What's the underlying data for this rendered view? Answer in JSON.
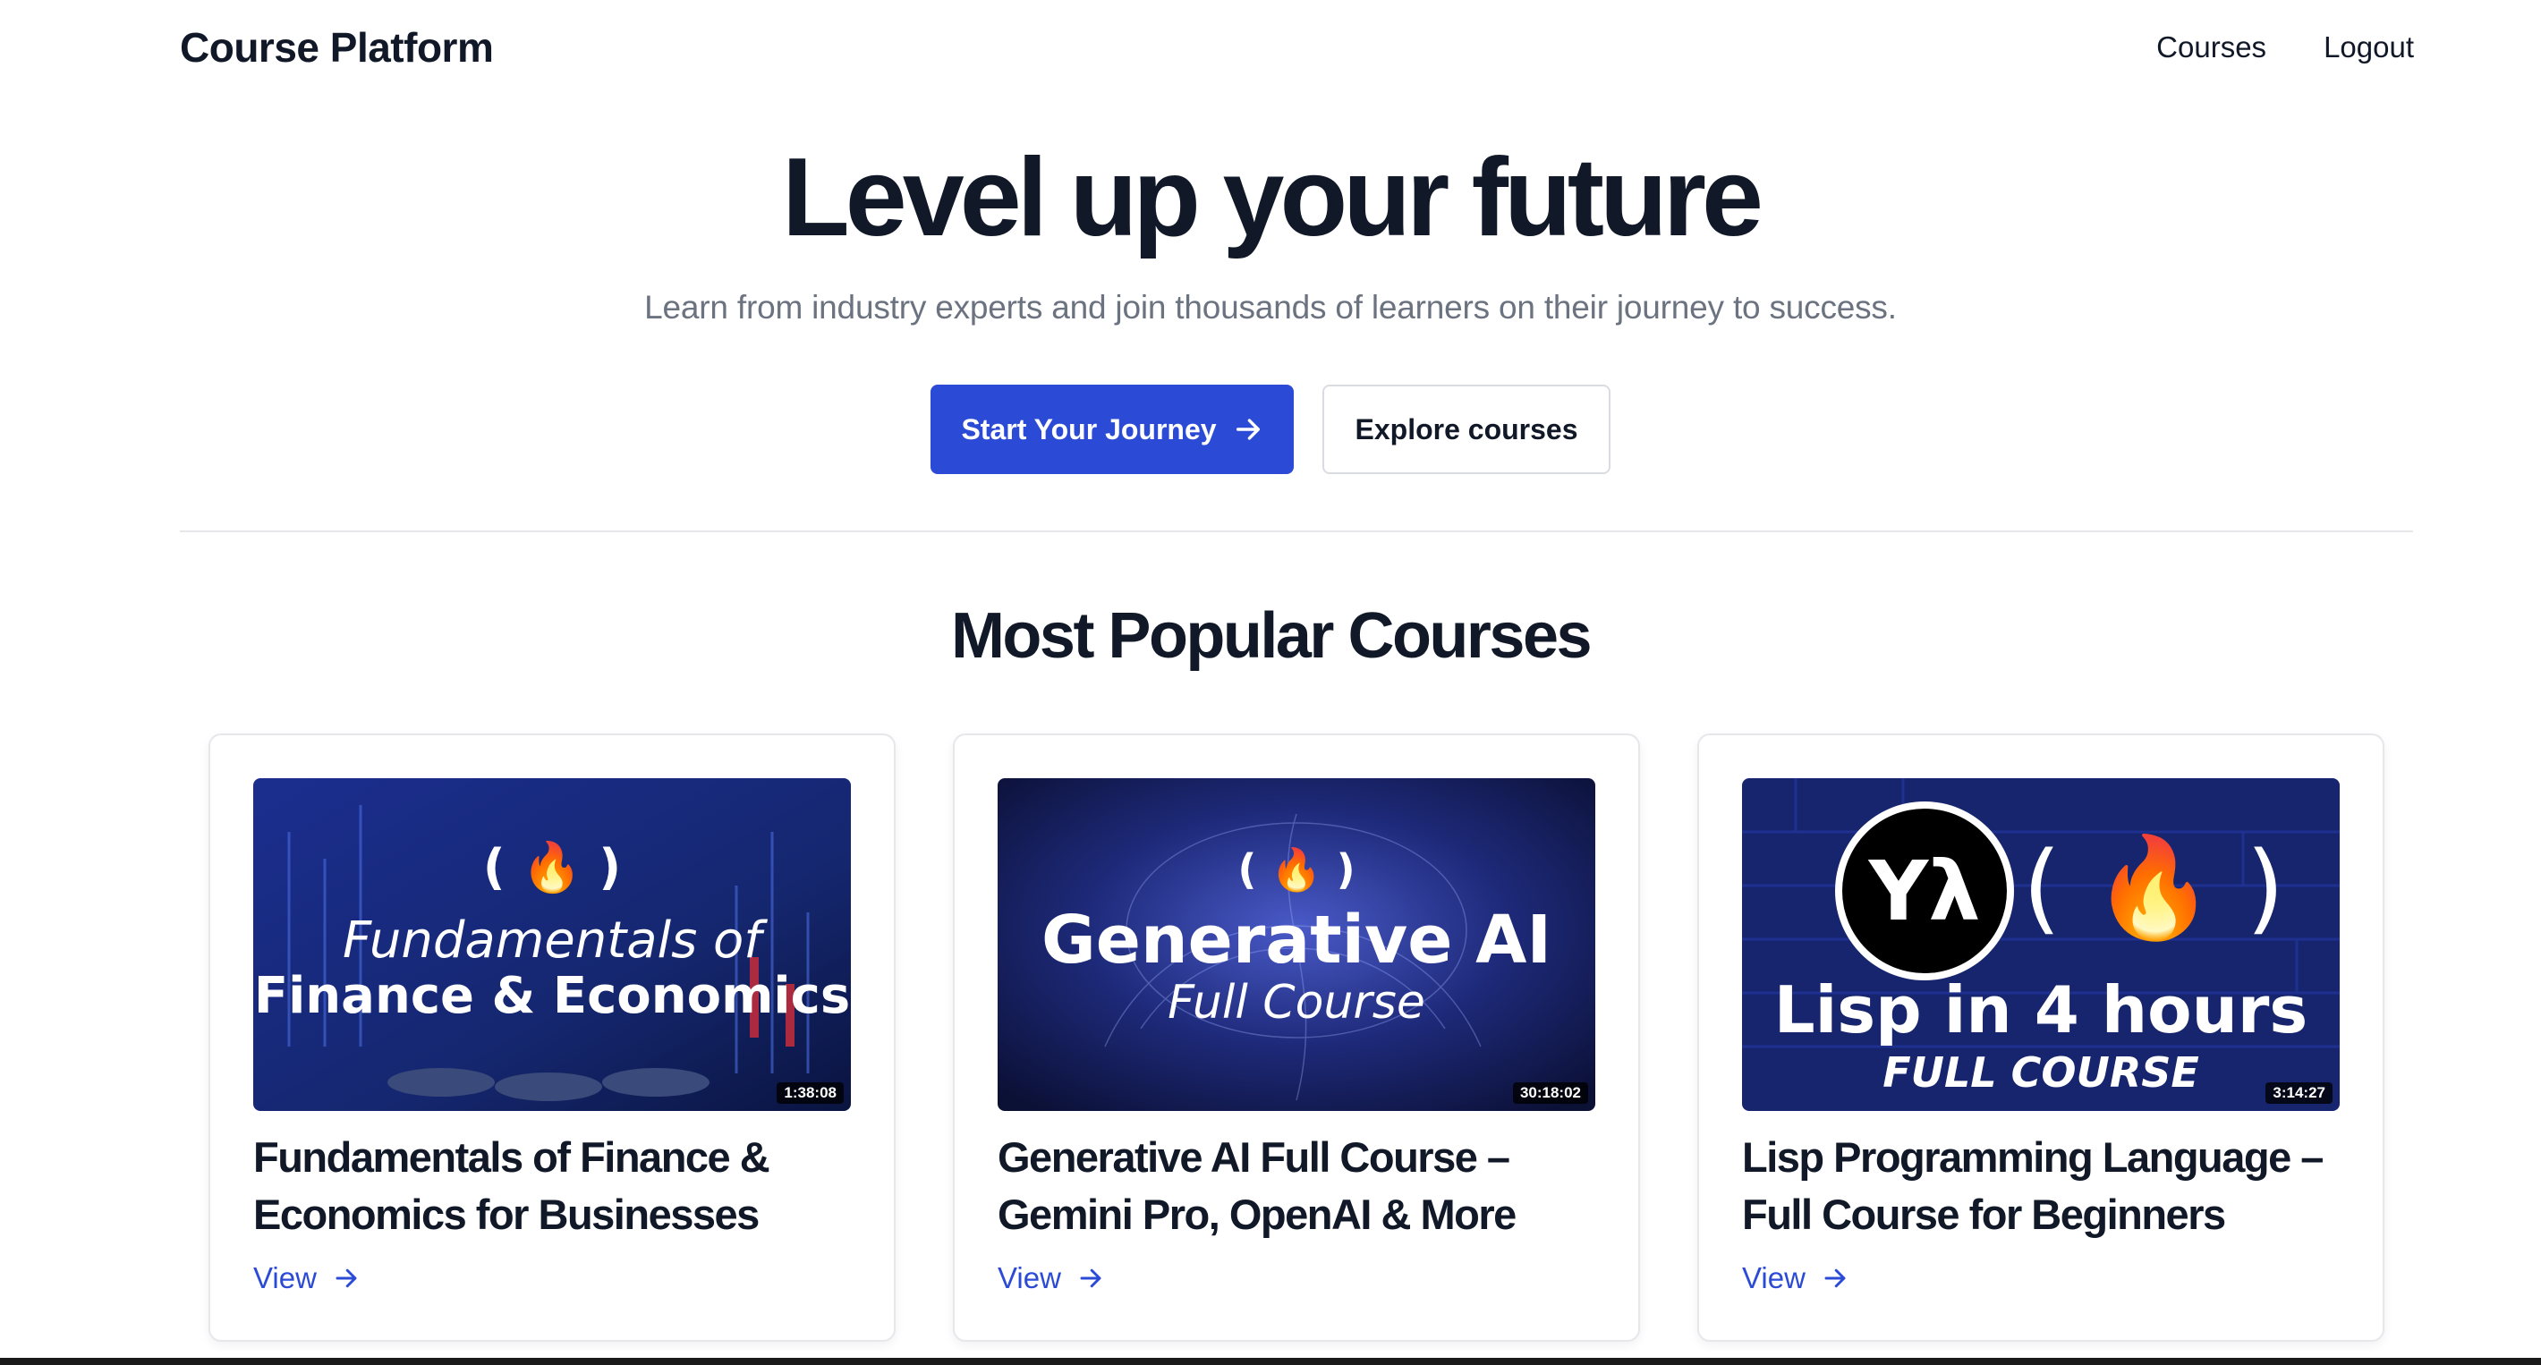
{
  "header": {
    "brand": "Course Platform",
    "nav": [
      {
        "label": "Courses"
      },
      {
        "label": "Logout"
      }
    ]
  },
  "hero": {
    "title": "Level up your future",
    "subtitle": "Learn from industry experts and join thousands of learners on their journey to success.",
    "primary_cta": "Start Your Journey",
    "secondary_cta": "Explore courses"
  },
  "popular": {
    "title": "Most Popular Courses",
    "courses": [
      {
        "title": "Fundamentals of Finance & Economics for Businesses",
        "thumb_line1": "Fundamentals of",
        "thumb_line2": "Finance & Economics",
        "duration": "1:38:08",
        "view": "View"
      },
      {
        "title": "Generative AI Full Course – Gemini Pro, OpenAI & More",
        "thumb_line1": "Generative AI",
        "thumb_line2": "Full Course",
        "duration": "30:18:02",
        "view": "View"
      },
      {
        "title": "Lisp Programming Language – Full Course for Beginners",
        "thumb_line1": "Lisp in 4 hours",
        "thumb_line2": "FULL COURSE",
        "duration": "3:14:27",
        "view": "View"
      }
    ]
  },
  "colors": {
    "primary": "#2b4bd6",
    "text": "#111827",
    "muted": "#6b7280",
    "border": "#e5e7eb"
  }
}
